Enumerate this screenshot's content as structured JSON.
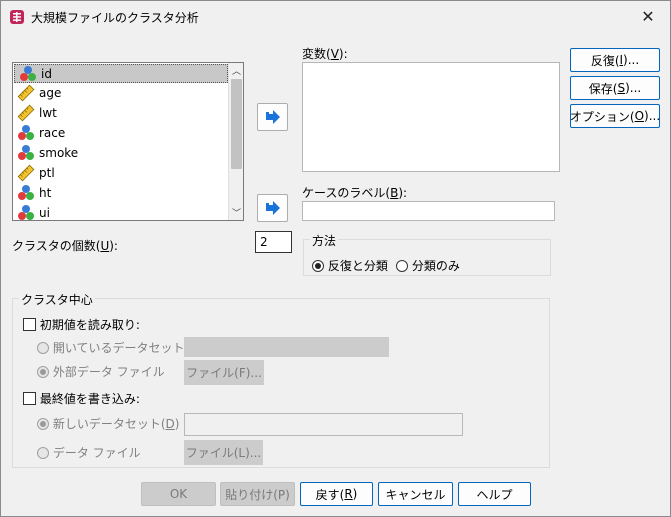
{
  "window": {
    "title": "大規模ファイルのクラスタ分析",
    "close_glyph": "✕"
  },
  "variable_list": {
    "items": [
      {
        "label": "id",
        "type": "nominal",
        "selected": true
      },
      {
        "label": "age",
        "type": "scale",
        "selected": false
      },
      {
        "label": "lwt",
        "type": "scale",
        "selected": false
      },
      {
        "label": "race",
        "type": "nominal",
        "selected": false
      },
      {
        "label": "smoke",
        "type": "nominal",
        "selected": false
      },
      {
        "label": "ptl",
        "type": "scale",
        "selected": false
      },
      {
        "label": "ht",
        "type": "nominal",
        "selected": false
      },
      {
        "label": "ui",
        "type": "nominal",
        "selected": false
      }
    ],
    "scroll_up_glyph": "︿",
    "scroll_down_glyph": "﹀"
  },
  "variables": {
    "label_pre": "変数(",
    "label_key": "V",
    "label_post": "):"
  },
  "case_label": {
    "label_pre": "ケースのラベル(",
    "label_key": "B",
    "label_post": "):"
  },
  "cluster_count": {
    "label_pre": "クラスタの個数(",
    "label_key": "U",
    "label_post": "):",
    "value": "2"
  },
  "method": {
    "title": "方法",
    "options": [
      {
        "label": "反復と分類",
        "selected": true
      },
      {
        "label": "分類のみ",
        "selected": false
      }
    ]
  },
  "side_buttons": {
    "iterate": {
      "pre": "反復(",
      "key": "I",
      "post": ")..."
    },
    "save": {
      "pre": "保存(",
      "key": "S",
      "post": ")..."
    },
    "options": {
      "pre": "オプション(",
      "key": "O",
      "post": ")..."
    }
  },
  "cluster_centers": {
    "title": "クラスタ中心",
    "read_initial": {
      "label": "初期値を読み取り:",
      "checked": false
    },
    "open_dataset": {
      "label": "開いているデータセット",
      "selected": false
    },
    "external_file": {
      "label": "外部データ ファイル",
      "selected": true
    },
    "file_button_1": "ファイル(F)...",
    "write_final": {
      "label": "最終値を書き込み:",
      "checked": false
    },
    "new_dataset": {
      "pre": "新しいデータセット(",
      "key": "D",
      "post": ")",
      "selected": true
    },
    "data_file": {
      "label": "データ ファイル",
      "selected": false
    },
    "file_button_2": "ファイル(L)..."
  },
  "footer_buttons": {
    "ok": "OK",
    "paste": "貼り付け(P)",
    "reset": {
      "pre": "戻す(",
      "key": "R",
      "post": ")"
    },
    "cancel": "キャンセル",
    "help": "ヘルプ"
  },
  "colors": {
    "accent": "#0067c0",
    "arrow": "#1a73d9",
    "disabled_fill": "#cccccc"
  }
}
